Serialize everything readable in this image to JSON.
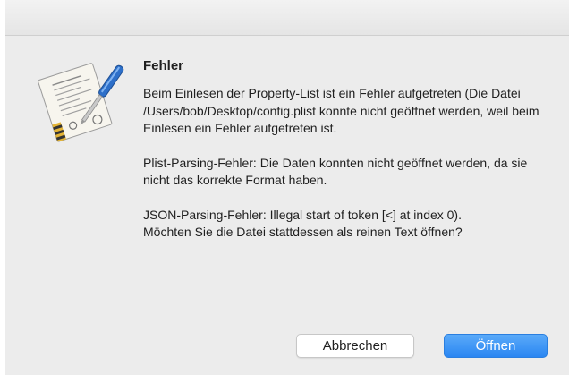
{
  "dialog": {
    "title": "Fehler",
    "paragraphs": [
      "Beim Einlesen der Property-List ist ein Fehler aufgetreten (Die Datei /Users/bob/Desktop/config.plist konnte nicht geöffnet werden, weil beim Einlesen ein Fehler aufgetreten ist.",
      "Plist-Parsing-Fehler: Die Daten konnten nicht geöffnet werden, da sie nicht das korrekte Format haben.",
      "JSON-Parsing-Fehler: Illegal start of token [<] at index 0).",
      "Möchten Sie die Datei stattdessen als reinen Text öffnen?"
    ],
    "icon": "property-list-editor-app-icon"
  },
  "buttons": {
    "cancel_label": "Abbrechen",
    "open_label": "Öffnen"
  },
  "colors": {
    "dialog_background": "#ececec",
    "default_button": "#2a86f2",
    "text": "#1f1f1f"
  }
}
